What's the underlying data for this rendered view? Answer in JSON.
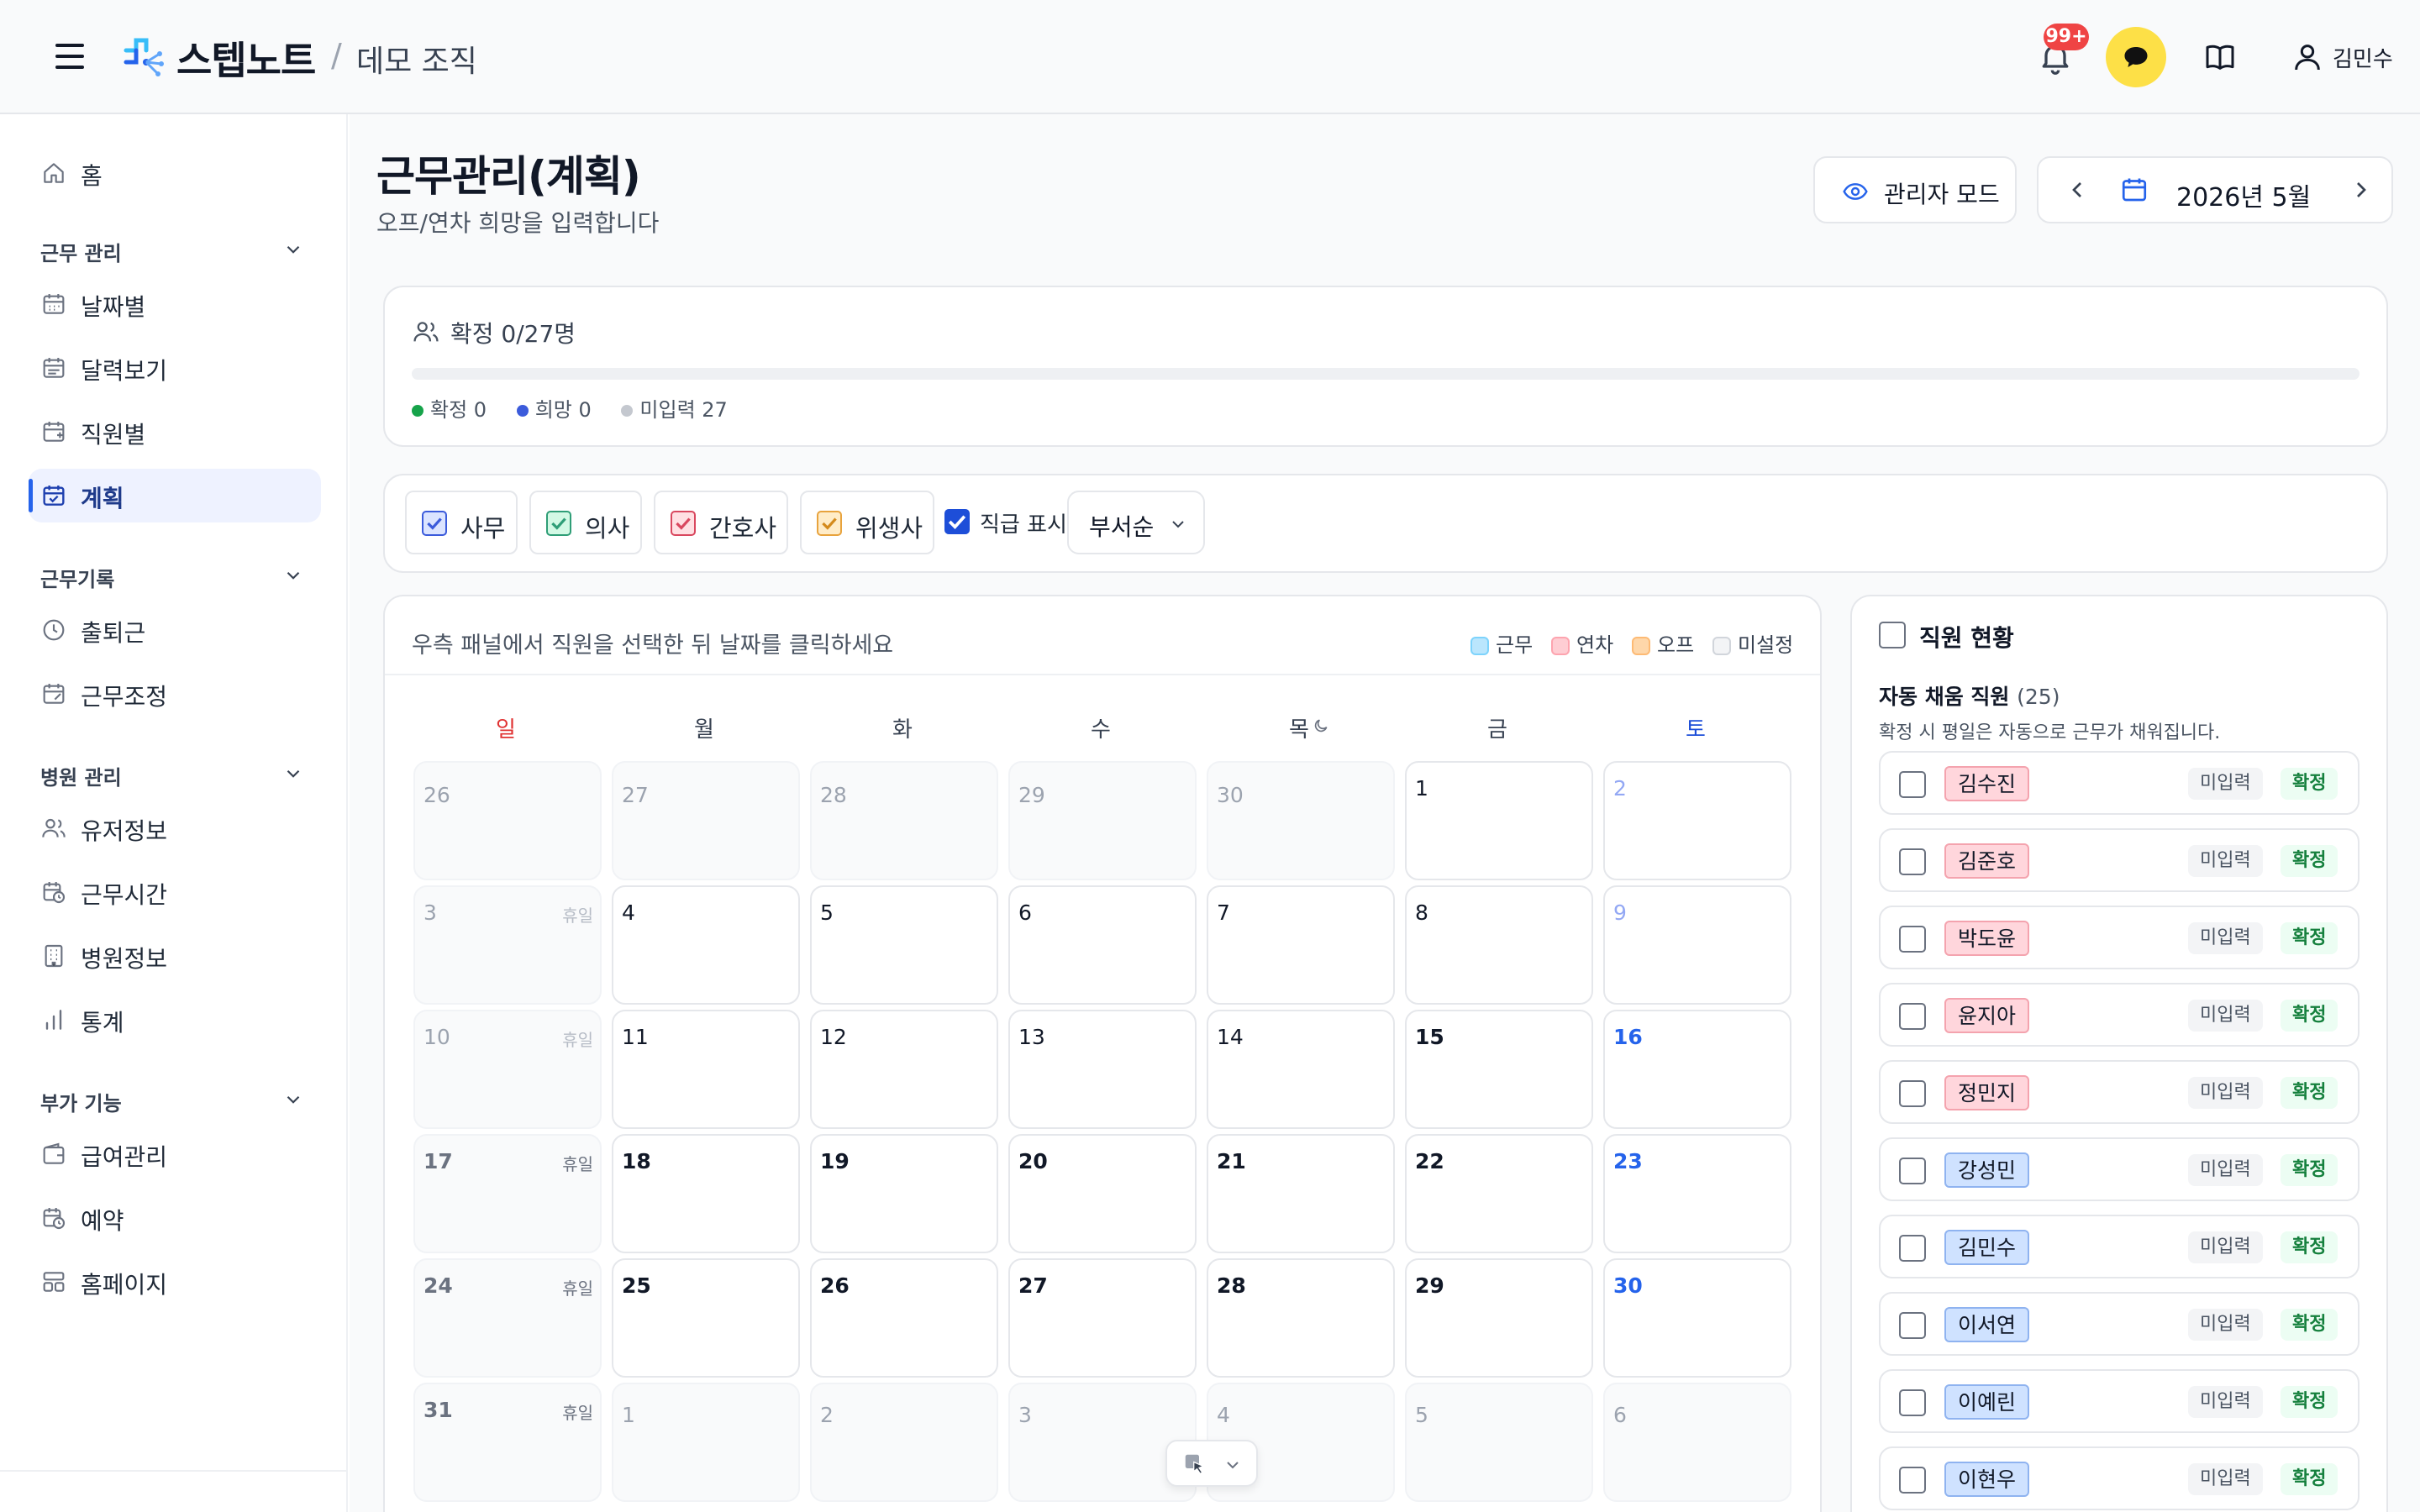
{
  "header": {
    "brand": "스텝노트",
    "separator": "/",
    "org": "데모 조직",
    "notification_badge": "99+",
    "user_name": "김민수"
  },
  "sidebar": {
    "home": "홈",
    "sections": [
      {
        "title": "근무 관리",
        "items": [
          "날짜별",
          "달력보기",
          "직원별",
          "계획"
        ]
      },
      {
        "title": "근무기록",
        "items": [
          "출퇴근",
          "근무조정"
        ]
      },
      {
        "title": "병원 관리",
        "items": [
          "유저정보",
          "근무시간",
          "병원정보",
          "통계"
        ]
      },
      {
        "title": "부가 기능",
        "items": [
          "급여관리",
          "예약",
          "홈페이지"
        ]
      }
    ],
    "active": "계획"
  },
  "page": {
    "title": "근무관리(계획)",
    "subtitle": "오프/연차 희망을 입력합니다",
    "admin_mode": "관리자 모드",
    "month": "2026년 5월"
  },
  "status": {
    "title": "확정 0/27명",
    "confirmed": "확정 0",
    "hope": "희망 0",
    "unentered": "미입력 27",
    "progress": 0
  },
  "filters": {
    "roles": [
      {
        "label": "사무",
        "checked": true,
        "color": "#3b5bdb",
        "bg": "#dbe4ff"
      },
      {
        "label": "의사",
        "checked": true,
        "color": "#2f9e77",
        "bg": "#d3f9e5"
      },
      {
        "label": "간호사",
        "checked": true,
        "color": "#d9485f",
        "bg": "#ffe0e3"
      },
      {
        "label": "위생사",
        "checked": true,
        "color": "#e8a33d",
        "bg": "#ffecc8"
      }
    ],
    "show_rank": "직급 표시",
    "sort": "부서순"
  },
  "calendar": {
    "instruction": "우측 패널에서 직원을 선택한 뒤 날짜를 클릭하세요",
    "legend": [
      "근무",
      "연차",
      "오프",
      "미설정"
    ],
    "weekdays": [
      "일",
      "월",
      "화",
      "수",
      "목",
      "금",
      "토"
    ],
    "holiday_label": "휴일",
    "weeks": [
      [
        {
          "d": "26",
          "s": "prev"
        },
        {
          "d": "27",
          "s": "prev"
        },
        {
          "d": "28",
          "s": "prev"
        },
        {
          "d": "29",
          "s": "prev"
        },
        {
          "d": "30",
          "s": "prev"
        },
        {
          "d": "1",
          "s": "cur"
        },
        {
          "d": "2",
          "s": "cur-sat"
        }
      ],
      [
        {
          "d": "3",
          "s": "hol-light"
        },
        {
          "d": "4",
          "s": "cur"
        },
        {
          "d": "5",
          "s": "cur"
        },
        {
          "d": "6",
          "s": "cur"
        },
        {
          "d": "7",
          "s": "cur"
        },
        {
          "d": "8",
          "s": "cur"
        },
        {
          "d": "9",
          "s": "cur-sat"
        }
      ],
      [
        {
          "d": "10",
          "s": "hol-light"
        },
        {
          "d": "11",
          "s": "cur"
        },
        {
          "d": "12",
          "s": "cur"
        },
        {
          "d": "13",
          "s": "cur"
        },
        {
          "d": "14",
          "s": "cur"
        },
        {
          "d": "15",
          "s": "bold"
        },
        {
          "d": "16",
          "s": "sat-bold"
        }
      ],
      [
        {
          "d": "17",
          "s": "hol"
        },
        {
          "d": "18",
          "s": "bold"
        },
        {
          "d": "19",
          "s": "bold"
        },
        {
          "d": "20",
          "s": "bold"
        },
        {
          "d": "21",
          "s": "bold"
        },
        {
          "d": "22",
          "s": "bold"
        },
        {
          "d": "23",
          "s": "sat-bold"
        }
      ],
      [
        {
          "d": "24",
          "s": "hol"
        },
        {
          "d": "25",
          "s": "bold"
        },
        {
          "d": "26",
          "s": "bold"
        },
        {
          "d": "27",
          "s": "bold"
        },
        {
          "d": "28",
          "s": "bold"
        },
        {
          "d": "29",
          "s": "bold"
        },
        {
          "d": "30",
          "s": "sat-bold"
        }
      ],
      [
        {
          "d": "31",
          "s": "hol"
        },
        {
          "d": "1",
          "s": "next"
        },
        {
          "d": "2",
          "s": "next"
        },
        {
          "d": "3",
          "s": "next"
        },
        {
          "d": "4",
          "s": "next"
        },
        {
          "d": "5",
          "s": "next"
        },
        {
          "d": "6",
          "s": "next"
        }
      ]
    ]
  },
  "employees": {
    "title": "직원 현황",
    "auto_label": "자동 채움 직원",
    "auto_count": "(25)",
    "note": "확정 시 평일은 자동으로 근무가 채워집니다.",
    "status_label": "미입력",
    "confirm_label": "확정",
    "list": [
      {
        "name": "김수진",
        "type": "nurse"
      },
      {
        "name": "김준호",
        "type": "nurse"
      },
      {
        "name": "박도윤",
        "type": "nurse"
      },
      {
        "name": "윤지아",
        "type": "nurse"
      },
      {
        "name": "정민지",
        "type": "nurse"
      },
      {
        "name": "강성민",
        "type": "office"
      },
      {
        "name": "김민수",
        "type": "office"
      },
      {
        "name": "이서연",
        "type": "office"
      },
      {
        "name": "이예린",
        "type": "office"
      },
      {
        "name": "이현우",
        "type": "office"
      }
    ]
  }
}
